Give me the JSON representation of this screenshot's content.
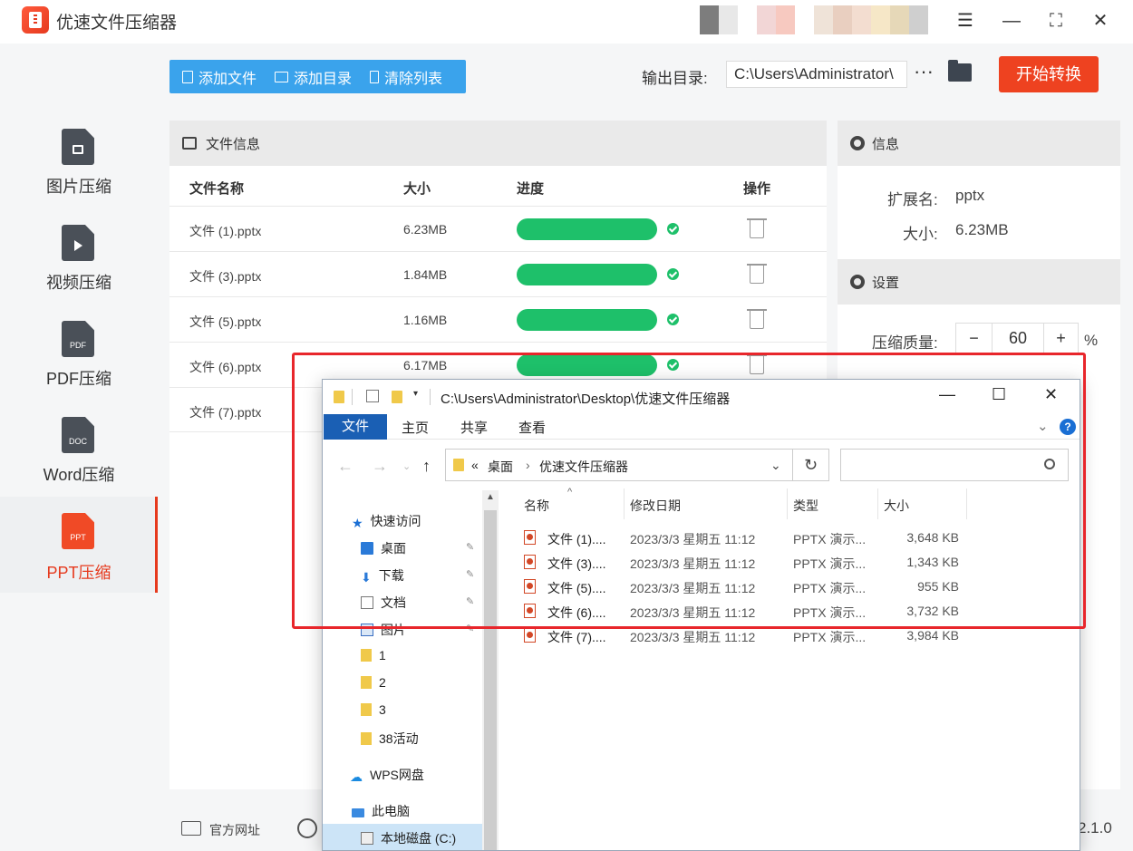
{
  "app": {
    "title": "优速文件压缩器"
  },
  "sidebar": {
    "items": [
      {
        "label": "图片压缩",
        "tag": ""
      },
      {
        "label": "视频压缩",
        "tag": ""
      },
      {
        "label": "PDF压缩",
        "tag": "PDF"
      },
      {
        "label": "Word压缩",
        "tag": "DOC"
      },
      {
        "label": "PPT压缩",
        "tag": "PPT"
      }
    ]
  },
  "toolbar": {
    "add_file": "添加文件",
    "add_folder": "添加目录",
    "clear_list": "清除列表",
    "output_label": "输出目录:",
    "output_path": "C:\\Users\\Administrator\\",
    "more": "···",
    "start": "开始转换"
  },
  "file_panel": {
    "title": "文件信息",
    "columns": [
      "文件名称",
      "大小",
      "进度",
      "操作"
    ],
    "rows": [
      {
        "name": "文件 (1).pptx",
        "size": "6.23MB",
        "progress": 1.0
      },
      {
        "name": "文件 (3).pptx",
        "size": "1.84MB",
        "progress": 1.0
      },
      {
        "name": "文件 (5).pptx",
        "size": "1.16MB",
        "progress": 1.0
      },
      {
        "name": "文件 (6).pptx",
        "size": "6.17MB",
        "progress": 1.0
      },
      {
        "name": "文件 (7).pptx",
        "size": "",
        "progress": 1.0
      }
    ]
  },
  "info": {
    "title": "信息",
    "ext_label": "扩展名:",
    "ext_value": "pptx",
    "size_label": "大小:",
    "size_value": "6.23MB"
  },
  "settings": {
    "title": "设置",
    "quality_label": "压缩质量:",
    "quality_value": "60",
    "minus": "−",
    "plus": "+",
    "unit": "%"
  },
  "footer": {
    "website": "官方网址",
    "version": "2.1.0"
  },
  "explorer": {
    "title_path": "C:\\Users\\Administrator\\Desktop\\优速文件压缩器",
    "tabs": [
      "文件",
      "主页",
      "共享",
      "查看"
    ],
    "breadcrumb": [
      "桌面",
      "优速文件压缩器"
    ],
    "breadcrumb_prefix": "«",
    "columns": [
      "名称",
      "修改日期",
      "类型",
      "大小"
    ],
    "tree": [
      {
        "label": "快速访问",
        "pinned": false
      },
      {
        "label": "桌面",
        "pinned": true
      },
      {
        "label": "下载",
        "pinned": true
      },
      {
        "label": "文档",
        "pinned": true
      },
      {
        "label": "图片",
        "pinned": true
      },
      {
        "label": "1",
        "pinned": false
      },
      {
        "label": "2",
        "pinned": false
      },
      {
        "label": "3",
        "pinned": false
      },
      {
        "label": "38活动",
        "pinned": false
      },
      {
        "label": "WPS网盘",
        "pinned": false
      },
      {
        "label": "此电脑",
        "pinned": false
      },
      {
        "label": "本地磁盘 (C:)",
        "pinned": false
      }
    ],
    "files": [
      {
        "name": "文件 (1)....",
        "date": "2023/3/3 星期五 11:12",
        "type": "PPTX 演示...",
        "size": "3,648 KB"
      },
      {
        "name": "文件 (3)....",
        "date": "2023/3/3 星期五 11:12",
        "type": "PPTX 演示...",
        "size": "1,343 KB"
      },
      {
        "name": "文件 (5)....",
        "date": "2023/3/3 星期五 11:12",
        "type": "PPTX 演示...",
        "size": "955 KB"
      },
      {
        "name": "文件 (6)....",
        "date": "2023/3/3 星期五 11:12",
        "type": "PPTX 演示...",
        "size": "3,732 KB"
      },
      {
        "name": "文件 (7)....",
        "date": "2023/3/3 星期五 11:12",
        "type": "PPTX 演示...",
        "size": "3,984 KB"
      }
    ]
  },
  "colors": {
    "accent_red": "#ee4220",
    "toolbar_blue": "#3aa3ec",
    "progress_green": "#1ec06a",
    "highlight_box": "#e8262b"
  }
}
